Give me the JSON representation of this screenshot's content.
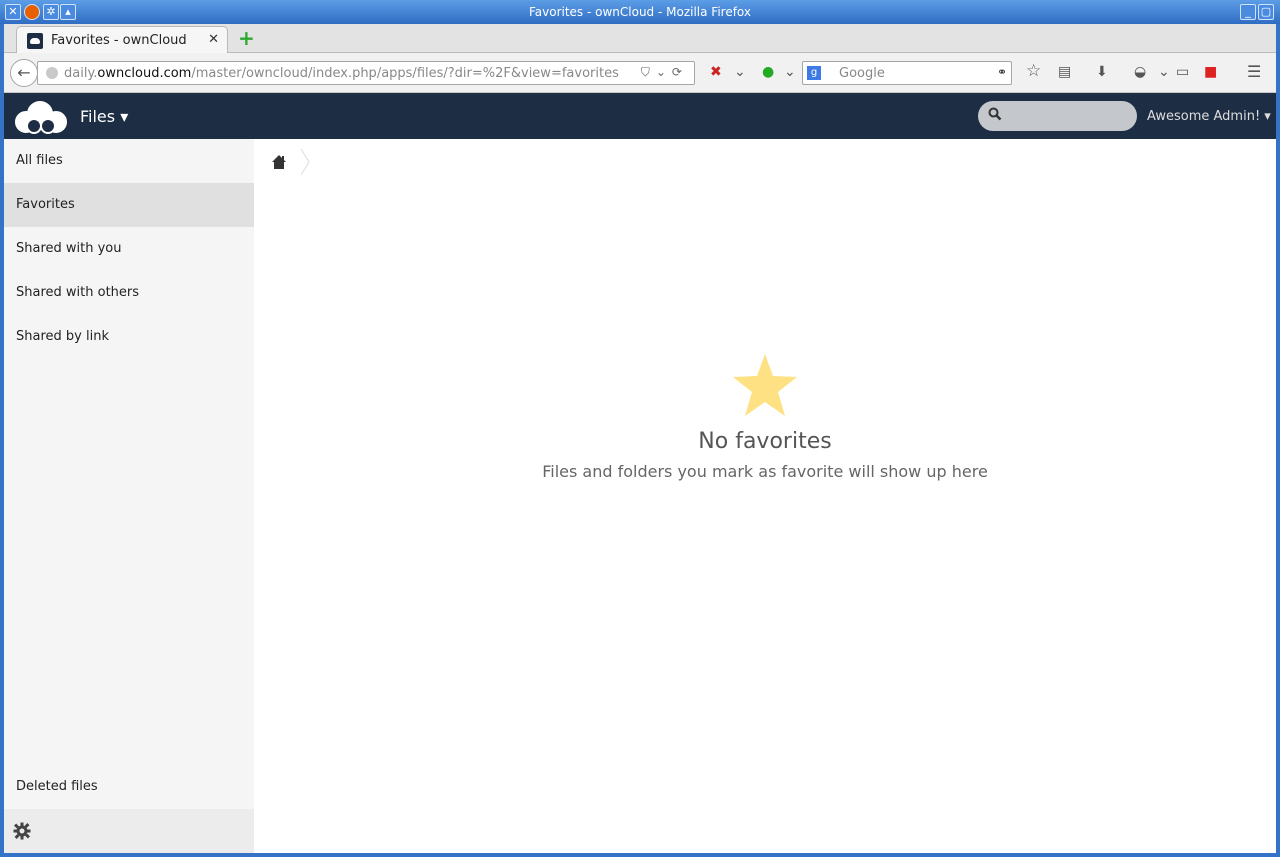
{
  "window": {
    "title": "Favorites - ownCloud - Mozilla Firefox"
  },
  "browser": {
    "tab_title": "Favorites - ownCloud",
    "new_tab_label": "+",
    "url_prefix": "daily.",
    "url_domain": "owncloud.com",
    "url_path": "/master/owncloud/index.php/apps/files/?dir=%2F&view=favorites",
    "search_placeholder": "Google"
  },
  "header": {
    "app_name": "Files ▾",
    "search_placeholder": "",
    "user_name": "Awesome Admin! ▾"
  },
  "sidebar": {
    "items": [
      {
        "label": "All files",
        "active": false
      },
      {
        "label": "Favorites",
        "active": true
      },
      {
        "label": "Shared with you",
        "active": false
      },
      {
        "label": "Shared with others",
        "active": false
      },
      {
        "label": "Shared by link",
        "active": false
      }
    ],
    "deleted_files": "Deleted files"
  },
  "empty_state": {
    "title": "No favorites",
    "message": "Files and folders you mark as favorite will show up here",
    "icon": "star-icon",
    "icon_color": "#fde182"
  },
  "colors": {
    "header_bg": "#1d2d44",
    "sidebar_bg": "#f5f5f5",
    "active_item_bg": "#e0e0e0"
  }
}
